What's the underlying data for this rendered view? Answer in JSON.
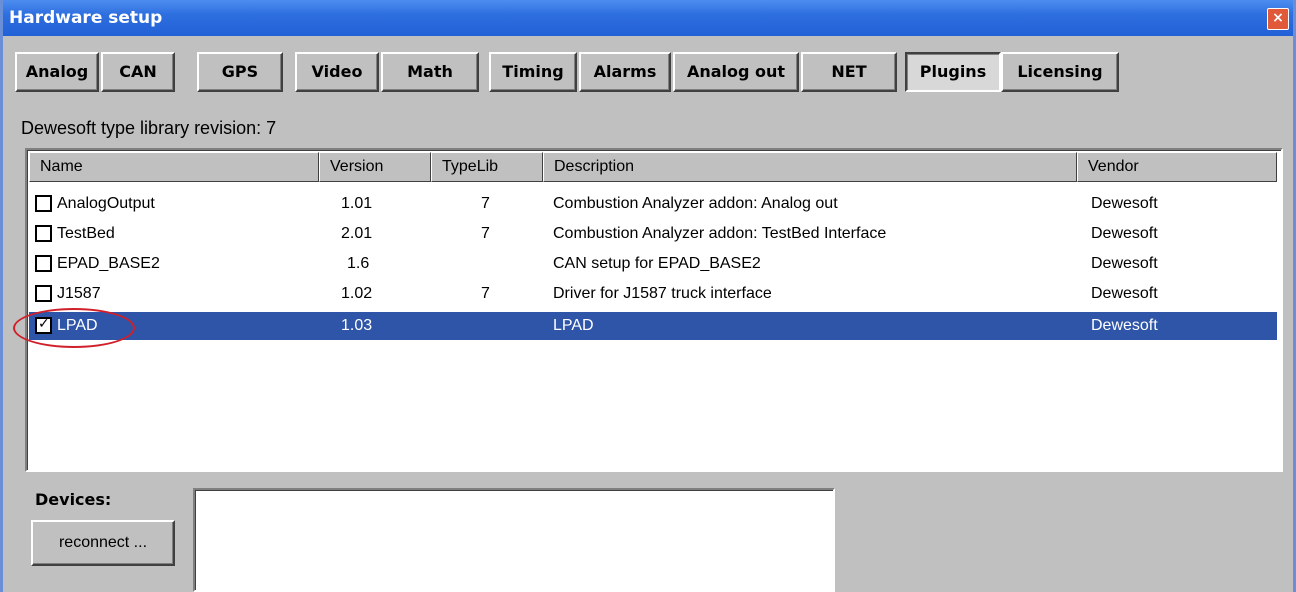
{
  "window": {
    "title": "Hardware setup",
    "close_glyph": "×",
    "accent_color": "#2e6fe0"
  },
  "tabs": [
    {
      "label": "Analog"
    },
    {
      "label": "CAN"
    },
    {
      "label": "GPS"
    },
    {
      "label": "Video"
    },
    {
      "label": "Math"
    },
    {
      "label": "Timing"
    },
    {
      "label": "Alarms"
    },
    {
      "label": "Analog out"
    },
    {
      "label": "NET"
    },
    {
      "label": "Plugins",
      "active": true
    },
    {
      "label": "Licensing"
    }
  ],
  "library": {
    "label": "Dewesoft type library revision:",
    "revision": "7"
  },
  "plugin_list": {
    "columns": [
      "Name",
      "Version",
      "TypeLib",
      "Description",
      "Vendor"
    ],
    "rows": [
      {
        "name": "AnalogOutput",
        "version": "1.01",
        "typelib": "7",
        "description": "Combustion Analyzer addon: Analog out",
        "vendor": "Dewesoft",
        "checked": false,
        "selected": false
      },
      {
        "name": "TestBed",
        "version": "2.01",
        "typelib": "7",
        "description": "Combustion Analyzer addon: TestBed Interface",
        "vendor": "Dewesoft",
        "checked": false,
        "selected": false
      },
      {
        "name": "EPAD_BASE2",
        "version": "1.6",
        "typelib": "",
        "description": "CAN setup for EPAD_BASE2",
        "vendor": "Dewesoft",
        "checked": false,
        "selected": false
      },
      {
        "name": "J1587",
        "version": "1.02",
        "typelib": "7",
        "description": "Driver for J1587 truck interface",
        "vendor": "Dewesoft",
        "checked": false,
        "selected": false
      },
      {
        "name": "LPAD",
        "version": "1.03",
        "typelib": "",
        "description": "LPAD",
        "vendor": "Dewesoft",
        "checked": true,
        "selected": true
      }
    ],
    "selection_color": "#2e55a8",
    "highlight_color": "#d0202a"
  },
  "devices": {
    "label": "Devices:",
    "reconnect_label": "reconnect ..."
  }
}
